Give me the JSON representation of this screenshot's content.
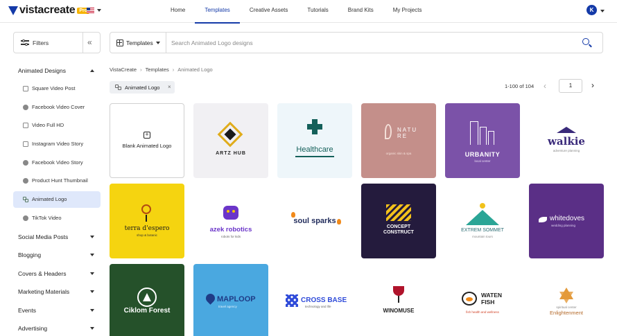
{
  "header": {
    "brand": "vistacreate",
    "badge": "Pro",
    "nav": [
      "Home",
      "Templates",
      "Creative Assets",
      "Tutorials",
      "Brand Kits",
      "My Projects"
    ],
    "active_nav": "Templates",
    "avatar_initial": "K",
    "accent_color": "#143aa8"
  },
  "sidebar": {
    "filters_label": "Filters",
    "sections": [
      {
        "label": "Animated Designs",
        "expanded": true
      },
      {
        "label": "Social Media Posts"
      },
      {
        "label": "Blogging"
      },
      {
        "label": "Covers & Headers"
      },
      {
        "label": "Marketing Materials"
      },
      {
        "label": "Events"
      },
      {
        "label": "Advertising"
      }
    ],
    "items": [
      {
        "label": "Square Video Post",
        "icon": "play-square-icon"
      },
      {
        "label": "Facebook Video Cover",
        "icon": "facebook-icon"
      },
      {
        "label": "Video Full HD",
        "icon": "play-square-icon"
      },
      {
        "label": "Instagram Video Story",
        "icon": "instagram-icon"
      },
      {
        "label": "Facebook Video Story",
        "icon": "facebook-icon"
      },
      {
        "label": "Product Hunt Thumbnail",
        "icon": "product-hunt-icon"
      },
      {
        "label": "Animated Logo",
        "icon": "logo-icon",
        "active": true
      },
      {
        "label": "TikTok Video",
        "icon": "tiktok-icon"
      }
    ]
  },
  "search": {
    "category_label": "Templates",
    "placeholder": "Search Animated Logo designs"
  },
  "breadcrumb": [
    "VistaCreate",
    "Templates",
    "Animated Logo"
  ],
  "chip": {
    "label": "Animated Logo",
    "remove": "×"
  },
  "pagination": {
    "range": "1-100 of 104",
    "page": "1"
  },
  "grid": {
    "blank_label": "Blank Animated Logo",
    "cards": [
      {
        "title": "ARTZ HUB",
        "bg": "#f1f0f3"
      },
      {
        "title": "Healthcare",
        "bg": "#eef6fa"
      },
      {
        "title": "NATURE",
        "subtitle": "organic skin & spa",
        "bg": "#c48f8a"
      },
      {
        "title": "URBANITY",
        "subtitle": "local center",
        "bg": "#7b52a8"
      },
      {
        "title": "walkie",
        "subtitle": "adventure planning",
        "bg": "#ffffff"
      },
      {
        "title": "terra d'espero",
        "subtitle": "shop & botanic",
        "bg": "#f5d410"
      },
      {
        "title": "azek robotics",
        "subtitle": "robots for kids",
        "bg": "#ffffff"
      },
      {
        "title": "soul sparks",
        "bg": "#ffffff"
      },
      {
        "title": "CONCEPT CONSTRUCT",
        "bg": "#241b3d"
      },
      {
        "title": "EXTREM SOMMET",
        "subtitle": "mountain tours",
        "bg": "#ffffff"
      },
      {
        "title": "whitedoves",
        "subtitle": "wedding planning",
        "bg": "#5a2f86"
      },
      {
        "title": "Ciklom Forest",
        "bg": "#25512a"
      },
      {
        "title": "MAPLOOP",
        "subtitle": "travel agency",
        "bg": "#4aa8e0"
      },
      {
        "title": "CROSS BASE",
        "subtitle": "technology and life",
        "bg": "#ffffff"
      },
      {
        "title": "WINOMUSE",
        "bg": "#ffffff"
      },
      {
        "title": "WATEN FISH",
        "subtitle": "fish health and wellness",
        "bg": "#ffffff"
      },
      {
        "title": "Enlightenment",
        "subtitle": "spiritual center",
        "bg": "#ffffff"
      }
    ]
  }
}
